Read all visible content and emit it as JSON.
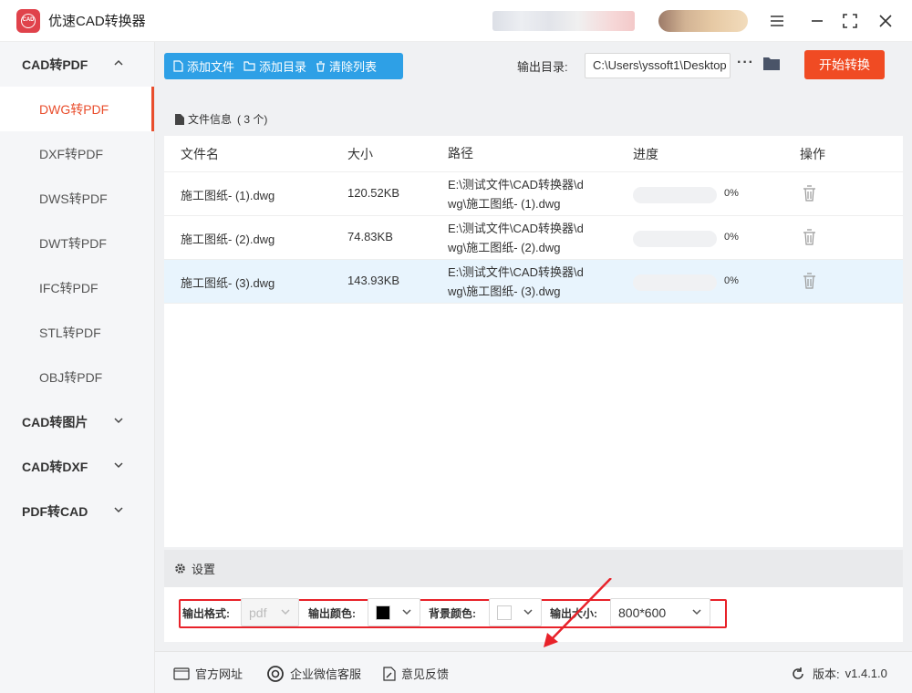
{
  "app": {
    "title": "优速CAD转换器",
    "logo_text": "CAD"
  },
  "sidebar": {
    "groups": [
      {
        "label": "CAD转PDF",
        "expanded": true,
        "items": [
          "DWG转PDF",
          "DXF转PDF",
          "DWS转PDF",
          "DWT转PDF",
          "IFC转PDF",
          "STL转PDF",
          "OBJ转PDF"
        ],
        "active_item": "DWG转PDF"
      },
      {
        "label": "CAD转图片",
        "expanded": false
      },
      {
        "label": "CAD转DXF",
        "expanded": false
      },
      {
        "label": "PDF转CAD",
        "expanded": false
      }
    ]
  },
  "toolbar": {
    "add_file": "添加文件",
    "add_folder": "添加目录",
    "clear_list": "清除列表",
    "output_dir_label": "输出目录:",
    "output_dir_value": "C:\\Users\\yssoft1\\Desktop",
    "more": "···",
    "start": "开始转换"
  },
  "file_panel": {
    "title": "文件信息",
    "count_text": "( 3 个)",
    "columns": {
      "name": "文件名",
      "size": "大小",
      "path": "路径",
      "progress": "进度",
      "action": "操作"
    },
    "rows": [
      {
        "name": "施工图纸- (1).dwg",
        "size": "120.52KB",
        "path_line1": "E:\\测试文件\\CAD转换器\\d",
        "path_line2": "wg\\施工图纸- (1).dwg",
        "progress": 0,
        "progress_text": "0%"
      },
      {
        "name": "施工图纸- (2).dwg",
        "size": "74.83KB",
        "path_line1": "E:\\测试文件\\CAD转换器\\d",
        "path_line2": "wg\\施工图纸- (2).dwg",
        "progress": 0,
        "progress_text": "0%"
      },
      {
        "name": "施工图纸- (3).dwg",
        "size": "143.93KB",
        "path_line1": "E:\\测试文件\\CAD转换器\\d",
        "path_line2": "wg\\施工图纸- (3).dwg",
        "progress": 0,
        "progress_text": "0%"
      }
    ]
  },
  "settings": {
    "title": "设置",
    "format_label": "输出格式:",
    "format_value": "pdf",
    "color_label": "输出颜色:",
    "color_value": "#000000",
    "bg_label": "背景颜色:",
    "bg_value": "#ffffff",
    "size_label": "输出大小:",
    "size_value": "800*600"
  },
  "footer": {
    "website": "官方网址",
    "wechat": "企业微信客服",
    "feedback": "意见反馈",
    "version_label": "版本:",
    "version_value": "v1.4.1.0"
  },
  "colors": {
    "accent": "#e94e2d",
    "blue": "#2ea0e6",
    "start": "#f04b23",
    "annotation": "#e8222a"
  }
}
